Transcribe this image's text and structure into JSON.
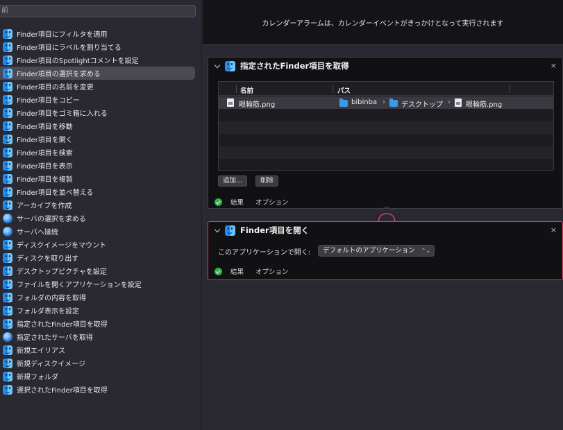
{
  "sidebar": {
    "search_placeholder": "前",
    "actions": [
      {
        "label": "Finder項目にフィルタを適用",
        "icon": "finder-icon"
      },
      {
        "label": "Finder項目にラベルを割り当てる",
        "icon": "finder-icon"
      },
      {
        "label": "Finder項目のSpotlightコメントを設定",
        "icon": "finder-icon"
      },
      {
        "label": "Finder項目の選択を求める",
        "icon": "finder-icon",
        "selected": true
      },
      {
        "label": "Finder項目の名前を変更",
        "icon": "finder-icon"
      },
      {
        "label": "Finder項目をコピー",
        "icon": "finder-icon"
      },
      {
        "label": "Finder項目をゴミ箱に入れる",
        "icon": "finder-icon"
      },
      {
        "label": "Finder項目を移動",
        "icon": "finder-icon"
      },
      {
        "label": "Finder項目を開く",
        "icon": "finder-icon"
      },
      {
        "label": "Finder項目を検索",
        "icon": "finder-icon"
      },
      {
        "label": "Finder項目を表示",
        "icon": "finder-icon"
      },
      {
        "label": "Finder項目を複製",
        "icon": "finder-icon"
      },
      {
        "label": "Finder項目を並べ替える",
        "icon": "finder-icon"
      },
      {
        "label": "アーカイブを作成",
        "icon": "finder-icon"
      },
      {
        "label": "サーバの選択を求める",
        "icon": "network-icon"
      },
      {
        "label": "サーバへ接続",
        "icon": "network-icon"
      },
      {
        "label": "ディスクイメージをマウント",
        "icon": "finder-icon"
      },
      {
        "label": "ディスクを取り出す",
        "icon": "finder-icon"
      },
      {
        "label": "デスクトップピクチャを設定",
        "icon": "finder-icon"
      },
      {
        "label": "ファイルを開くアプリケーションを設定",
        "icon": "finder-icon"
      },
      {
        "label": "フォルダの内容を取得",
        "icon": "finder-icon"
      },
      {
        "label": "フォルダ表示を設定",
        "icon": "finder-icon"
      },
      {
        "label": "指定されたFinder項目を取得",
        "icon": "finder-icon"
      },
      {
        "label": "指定されたサーバを取得",
        "icon": "network-icon"
      },
      {
        "label": "新規エイリアス",
        "icon": "finder-icon"
      },
      {
        "label": "新規ディスクイメージ",
        "icon": "finder-icon"
      },
      {
        "label": "新規フォルダ",
        "icon": "finder-icon"
      },
      {
        "label": "選択されたFinder項目を取得",
        "icon": "finder-icon"
      }
    ]
  },
  "workflow": {
    "description": "カレンダーアラームは、カレンダーイベントがきっかけとなって実行されます",
    "action1": {
      "title": "指定されたFinder項目を取得",
      "close": "×",
      "columns": {
        "name": "名前",
        "path": "パス"
      },
      "row": {
        "name": "眼輪筋.png",
        "path": [
          "bibinba",
          "デスクトップ",
          "眼輪筋.png"
        ],
        "sep": "›"
      },
      "add_button": "追加...",
      "delete_button": "削除",
      "results": "結果",
      "options": "オプション"
    },
    "action2": {
      "title": "Finder項目を開く",
      "close": "×",
      "open_with_label": "このアプリケーションで開く:",
      "open_with_value": "デフォルトのアプリケーション",
      "select_arrows": "⌃⌄",
      "results": "結果",
      "options": "オプション"
    }
  },
  "colors": {
    "accent_highlight": "#d6416e",
    "success": "#2fb24a",
    "finder_blue": "#1f8ef2"
  }
}
